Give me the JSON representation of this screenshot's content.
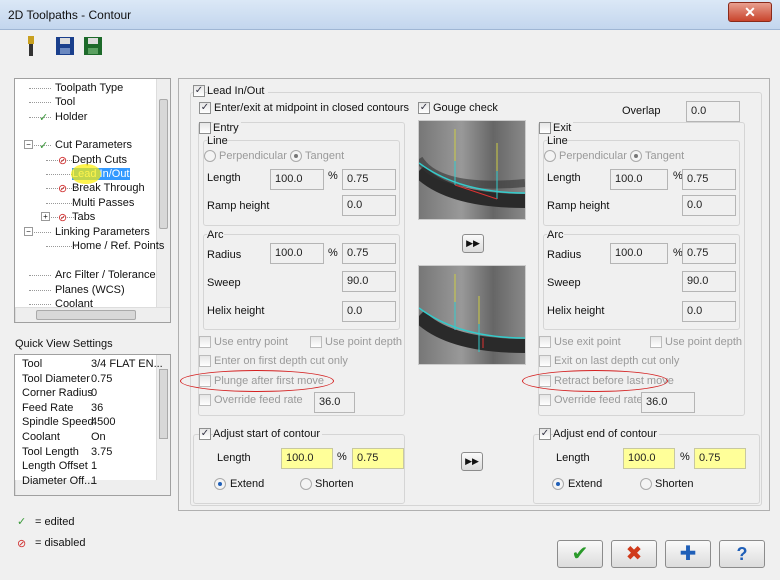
{
  "window": {
    "title": "2D Toolpaths - Contour",
    "close": "✕"
  },
  "toolbar": {
    "icons": [
      "tool-icon",
      "save-icon",
      "save-as-icon"
    ]
  },
  "tree": {
    "items": [
      {
        "label": "Toolpath Type",
        "state": "none"
      },
      {
        "label": "Tool",
        "state": "none"
      },
      {
        "label": "Holder",
        "state": "edited"
      },
      {
        "label": "Cut Parameters",
        "state": "edited"
      },
      {
        "label": "Depth Cuts",
        "state": "disabled"
      },
      {
        "label": "Lead In/Out",
        "state": "selected"
      },
      {
        "label": "Break Through",
        "state": "disabled"
      },
      {
        "label": "Multi Passes",
        "state": "none"
      },
      {
        "label": "Tabs",
        "state": "disabled"
      },
      {
        "label": "Linking Parameters",
        "state": "none"
      },
      {
        "label": "Home / Ref. Points",
        "state": "none"
      },
      {
        "label": "Arc Filter / Tolerance",
        "state": "none"
      },
      {
        "label": "Planes (WCS)",
        "state": "none"
      },
      {
        "label": "Coolant",
        "state": "none"
      }
    ]
  },
  "quick_view": {
    "title": "Quick View Settings",
    "rows": [
      [
        "Tool",
        "3/4 FLAT EN..."
      ],
      [
        "Tool Diameter",
        "0.75"
      ],
      [
        "Corner Radius",
        "0"
      ],
      [
        "Feed Rate",
        "36"
      ],
      [
        "Spindle Speed",
        "4500"
      ],
      [
        "Coolant",
        "On"
      ],
      [
        "Tool Length",
        "3.75"
      ],
      [
        "Length Offset",
        "1"
      ],
      [
        "Diameter Off...",
        "1"
      ]
    ]
  },
  "legend": {
    "edited": "= edited",
    "disabled": "= disabled"
  },
  "lead": {
    "label": "Lead In/Out",
    "midpoint": "Enter/exit at midpoint in closed contours",
    "gouge": "Gouge check",
    "overlap_label": "Overlap",
    "overlap": "0.0"
  },
  "entry": {
    "label": "Entry",
    "line": "Line",
    "perp": "Perpendicular",
    "tang": "Tangent",
    "length": "Length",
    "len_pct": "100.0",
    "pct": "%",
    "len_val": "0.75",
    "ramp": "Ramp height",
    "ramp_val": "0.0",
    "arc": "Arc",
    "radius": "Radius",
    "rad_pct": "100.0",
    "rad_val": "0.75",
    "sweep": "Sweep",
    "sweep_val": "90.0",
    "helix": "Helix height",
    "helix_val": "0.0",
    "use_point": "Use entry point",
    "use_depth": "Use point depth",
    "first": "Enter on first depth cut only",
    "plunge": "Plunge after first move",
    "override": "Override feed rate",
    "feed": "36.0"
  },
  "exit": {
    "label": "Exit",
    "line": "Line",
    "perp": "Perpendicular",
    "tang": "Tangent",
    "length": "Length",
    "len_pct": "100.0",
    "pct": "%",
    "len_val": "0.75",
    "ramp": "Ramp height",
    "ramp_val": "0.0",
    "arc": "Arc",
    "radius": "Radius",
    "rad_pct": "100.0",
    "rad_val": "0.75",
    "sweep": "Sweep",
    "sweep_val": "90.0",
    "helix": "Helix height",
    "helix_val": "0.0",
    "use_point": "Use exit point",
    "use_depth": "Use point depth",
    "first": "Exit on last depth cut only",
    "plunge": "Retract before last move",
    "override": "Override feed rate",
    "feed": "36.0"
  },
  "adjust_start": {
    "label": "Adjust start of contour",
    "length": "Length",
    "pct_val": "100.0",
    "pct": "%",
    "val": "0.75",
    "extend": "Extend",
    "shorten": "Shorten"
  },
  "adjust_end": {
    "label": "Adjust end of contour",
    "length": "Length",
    "pct_val": "100.0",
    "pct": "%",
    "val": "0.75",
    "extend": "Extend",
    "shorten": "Shorten"
  },
  "buttons": {
    "ok": "✔",
    "cancel": "✖",
    "add": "✚",
    "help": "?"
  }
}
